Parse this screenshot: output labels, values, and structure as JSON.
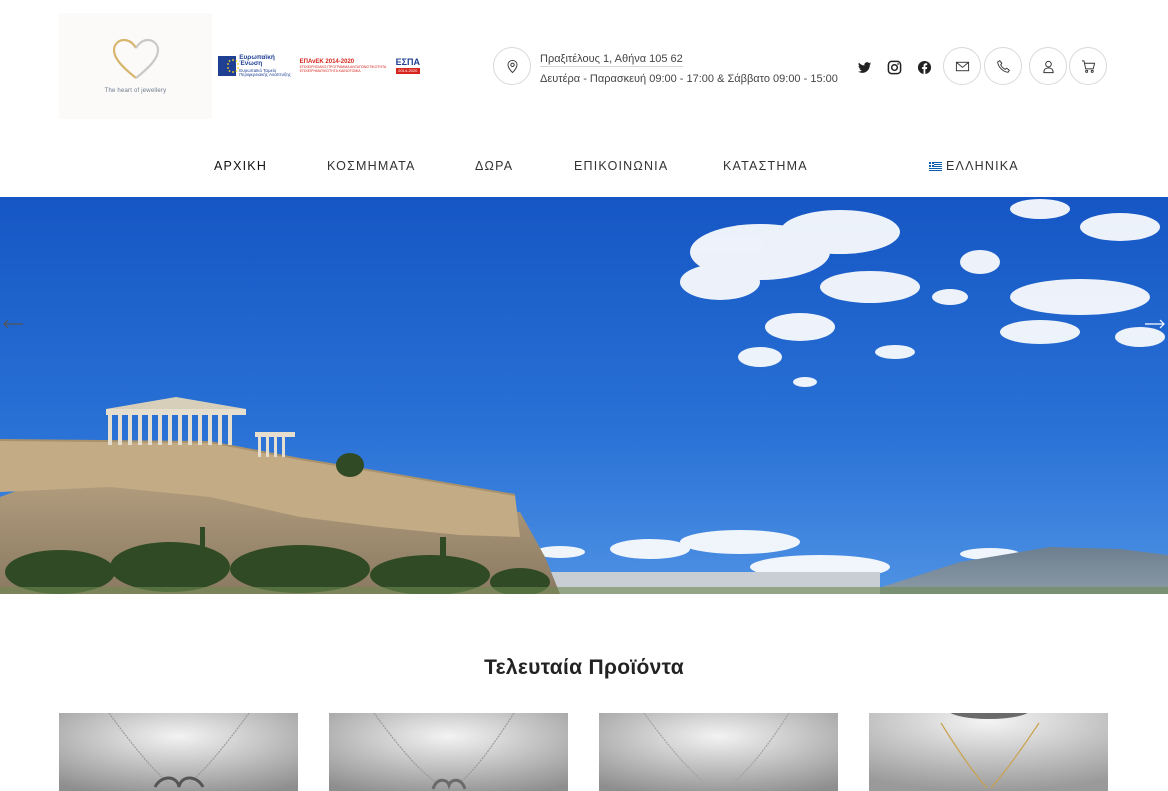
{
  "header": {
    "logo_tagline": "The heart of jewellery",
    "espa": {
      "eu_title": "Ευρωπαϊκή Ένωση",
      "eu_subtitle": "Ευρωπαϊκό Ταμείο Περιφερειακής Ανάπτυξης",
      "epanek_title": "ΕΠΑνΕΚ 2014-2020",
      "epanek_subtitle": "ΕΠΙΧΕΙΡΗΣΙΑΚΟ ΠΡΟΓΡΑΜΜΑ ΑΝΤΑΓΩΝΙΣΤΙΚΟΤΗΤΑ ΕΠΙΧΕΙΡΗΜΑΤΙΚΟΤΗΤΑ ΚΑΙΝΟΤΟΜΙΑ",
      "espa_title": "ΕΣΠΑ",
      "espa_years": "2014-2020"
    },
    "address": "Πραξιτέλους 1, Αθήνα 105 62",
    "hours": "Δευτέρα - Παρασκευή 09:00 - 17:00 & Σάββατο 09:00 - 15:00",
    "icons": {
      "location": "map-pin-icon",
      "twitter": "twitter-icon",
      "instagram": "instagram-icon",
      "facebook": "facebook-icon",
      "email": "envelope-icon",
      "phone": "phone-icon",
      "account": "user-icon",
      "cart": "cart-icon"
    }
  },
  "nav": {
    "items": [
      {
        "label": "ΑΡΧΙΚΗ",
        "active": true
      },
      {
        "label": "ΚΟΣΜΗΜΑΤΑ",
        "active": false
      },
      {
        "label": "ΔΩΡΑ",
        "active": false
      },
      {
        "label": "ΕΠΙΚΟΙΝΩΝΙΑ",
        "active": false
      },
      {
        "label": "ΚΑΤΑΣΤΗΜΑ",
        "active": false
      }
    ],
    "language": "ΕΛΛΗΝΙΚΑ"
  },
  "hero": {
    "prev_icon": "arrow-left-icon",
    "next_icon": "arrow-right-icon"
  },
  "products_section": {
    "title": "Τελευταία Προϊόντα"
  },
  "colors": {
    "sky": "#1f63c9",
    "text": "#222222",
    "border": "#d9d9d9",
    "gold": "#d7b56d"
  }
}
